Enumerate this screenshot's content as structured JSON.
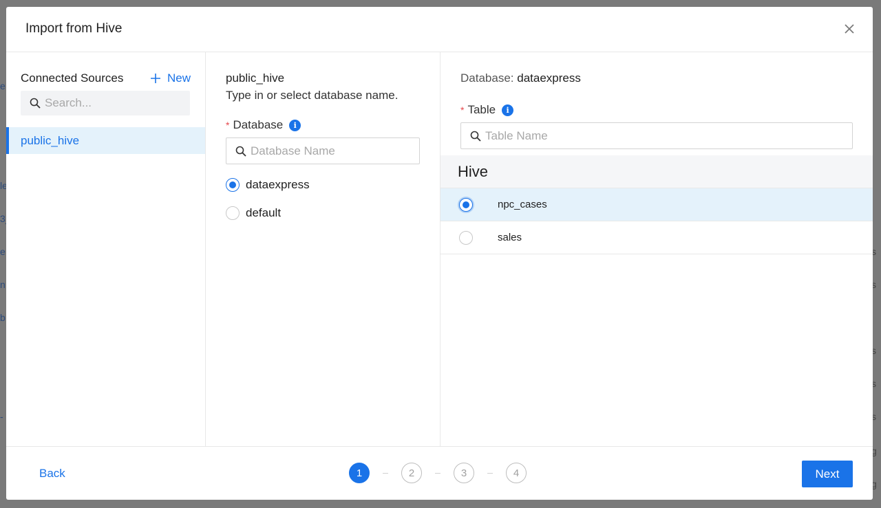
{
  "backdrop": {
    "left_fragments": [
      "e",
      "le",
      "3_",
      "e",
      "n",
      "b",
      "-"
    ],
    "right_fragments": [
      "s",
      "s",
      "s",
      "s",
      "s",
      "g",
      "g"
    ]
  },
  "dialog": {
    "title": "Import from Hive",
    "close_icon": "close-icon"
  },
  "sources": {
    "title": "Connected Sources",
    "new_label": "New",
    "search_placeholder": "Search...",
    "items": [
      {
        "label": "public_hive",
        "selected": true
      }
    ]
  },
  "database": {
    "source_name": "public_hive",
    "hint": "Type in or select database name.",
    "field_label": "Database",
    "required_mark": "*",
    "placeholder": "Database Name",
    "options": [
      {
        "label": "dataexpress",
        "selected": true
      },
      {
        "label": "default",
        "selected": false
      }
    ]
  },
  "table": {
    "db_prefix": "Database:",
    "db_value": "dataexpress",
    "field_label": "Table",
    "required_mark": "*",
    "placeholder": "Table Name",
    "group_header": "Hive",
    "rows": [
      {
        "label": "npc_cases",
        "selected": true
      },
      {
        "label": "sales",
        "selected": false
      }
    ]
  },
  "footer": {
    "back_label": "Back",
    "next_label": "Next",
    "steps": [
      "1",
      "2",
      "3",
      "4"
    ],
    "current_step": 1
  },
  "colors": {
    "accent": "#1a73e8",
    "selected_bg": "#e4f2fb",
    "required": "#e5484d"
  }
}
